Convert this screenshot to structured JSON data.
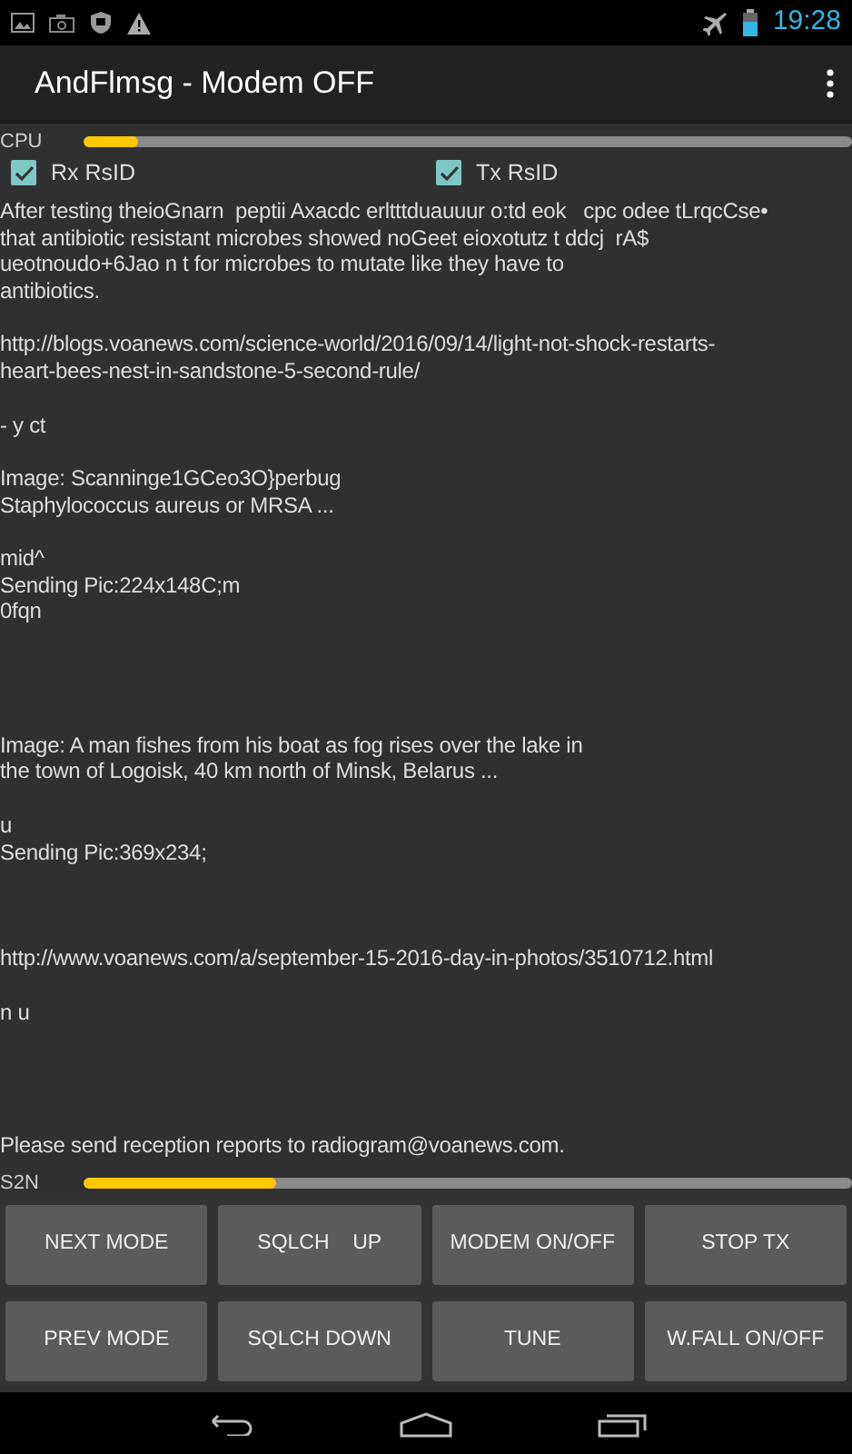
{
  "status_bar": {
    "time": "19:28"
  },
  "action_bar": {
    "title": "AndFlmsg - Modem OFF"
  },
  "cpu_meter": {
    "label": "CPU",
    "level": 0.07
  },
  "options": [
    {
      "label": "Rx RsID",
      "checked": true
    },
    {
      "label": "Tx RsID",
      "checked": true
    }
  ],
  "message_lines": [
    {
      "kind": "line",
      "text": "After testing theioGnarn  peptii Axacdc erltttduauuur o:td eok   cpc odee tLrqcCse•"
    },
    {
      "kind": "line",
      "text": "that antibiotic resistant microbes showed noGeet eioxotutz t ddcj  rA$"
    },
    {
      "kind": "line",
      "text": "ueotnoudo+6Jao n t for microbes to mutate like they have to"
    },
    {
      "kind": "line",
      "text": "antibiotics."
    },
    {
      "kind": "blank"
    },
    {
      "kind": "line",
      "text": "http://blogs.voanews.com/science-world/2016/09/14/light-not-shock-restarts-"
    },
    {
      "kind": "line",
      "text": "heart-bees-nest-in-sandstone-5-second-rule/"
    },
    {
      "kind": "blank"
    },
    {
      "kind": "line",
      "text": "- y ct"
    },
    {
      "kind": "blank"
    },
    {
      "kind": "line",
      "text": "Image: Scanninge1GCeo3O}perbug"
    },
    {
      "kind": "line",
      "text": "Staphylococcus aureus or MRSA ..."
    },
    {
      "kind": "blank"
    },
    {
      "kind": "line",
      "text": "mid^"
    },
    {
      "kind": "line",
      "text": "Sending Pic:224x148C;m"
    },
    {
      "kind": "line",
      "text": "0fqn"
    },
    {
      "kind": "blank"
    },
    {
      "kind": "blank"
    },
    {
      "kind": "blank"
    },
    {
      "kind": "blank"
    },
    {
      "kind": "line",
      "text": "Image: A man fishes from his boat as fog rises over the lake in"
    },
    {
      "kind": "line",
      "text": "the town of Logoisk, 40 km north of Minsk, Belarus ..."
    },
    {
      "kind": "blank"
    },
    {
      "kind": "line",
      "text": "u"
    },
    {
      "kind": "line",
      "text": "Sending Pic:369x234;"
    },
    {
      "kind": "blank"
    },
    {
      "kind": "blank"
    },
    {
      "kind": "blank"
    },
    {
      "kind": "line",
      "text": "http://www.voanews.com/a/september-15-2016-day-in-photos/3510712.html"
    },
    {
      "kind": "blank"
    },
    {
      "kind": "line",
      "text": "n u"
    },
    {
      "kind": "blank"
    },
    {
      "kind": "blank"
    },
    {
      "kind": "blank"
    },
    {
      "kind": "blank"
    },
    {
      "kind": "line",
      "text": "Please send reception reports to radiogram@voanews.com."
    }
  ],
  "s2n_meter": {
    "label": "S2N",
    "level": 0.25
  },
  "buttons": [
    {
      "label": "NEXT MODE"
    },
    {
      "label": "SQLCH    UP"
    },
    {
      "label": "MODEM ON/OFF"
    },
    {
      "label": "STOP TX"
    },
    {
      "label": "PREV MODE"
    },
    {
      "label": "SQLCH DOWN"
    },
    {
      "label": "TUNE"
    },
    {
      "label": "W.FALL ON/OFF"
    }
  ]
}
